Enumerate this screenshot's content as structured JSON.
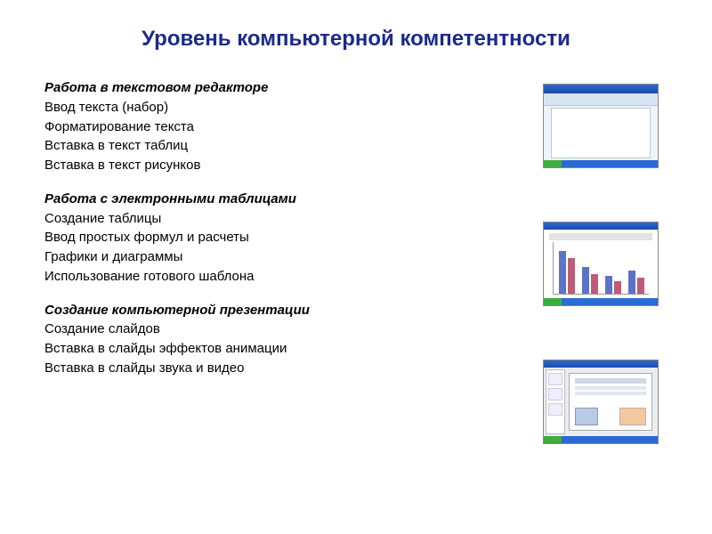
{
  "title": "Уровень компьютерной компетентности",
  "sections": [
    {
      "heading": "Работа в текстовом редакторе",
      "items": [
        "Ввод текста (набор)",
        "Форматирование текста",
        "Вставка в текст таблиц",
        "Вставка в текст рисунков"
      ],
      "thumbnail": "word-editor-thumbnail"
    },
    {
      "heading": "Работа с электронными таблицами",
      "items": [
        "Создание таблицы",
        "Ввод простых формул и расчеты",
        "Графики и диаграммы",
        "Использование готового шаблона"
      ],
      "thumbnail": "spreadsheet-chart-thumbnail"
    },
    {
      "heading": "Создание компьютерной презентации",
      "items": [
        "Создание слайдов",
        "Вставка в слайды эффектов анимации",
        "Вставка в слайды звука и видео"
      ],
      "thumbnail": "presentation-thumbnail"
    }
  ]
}
